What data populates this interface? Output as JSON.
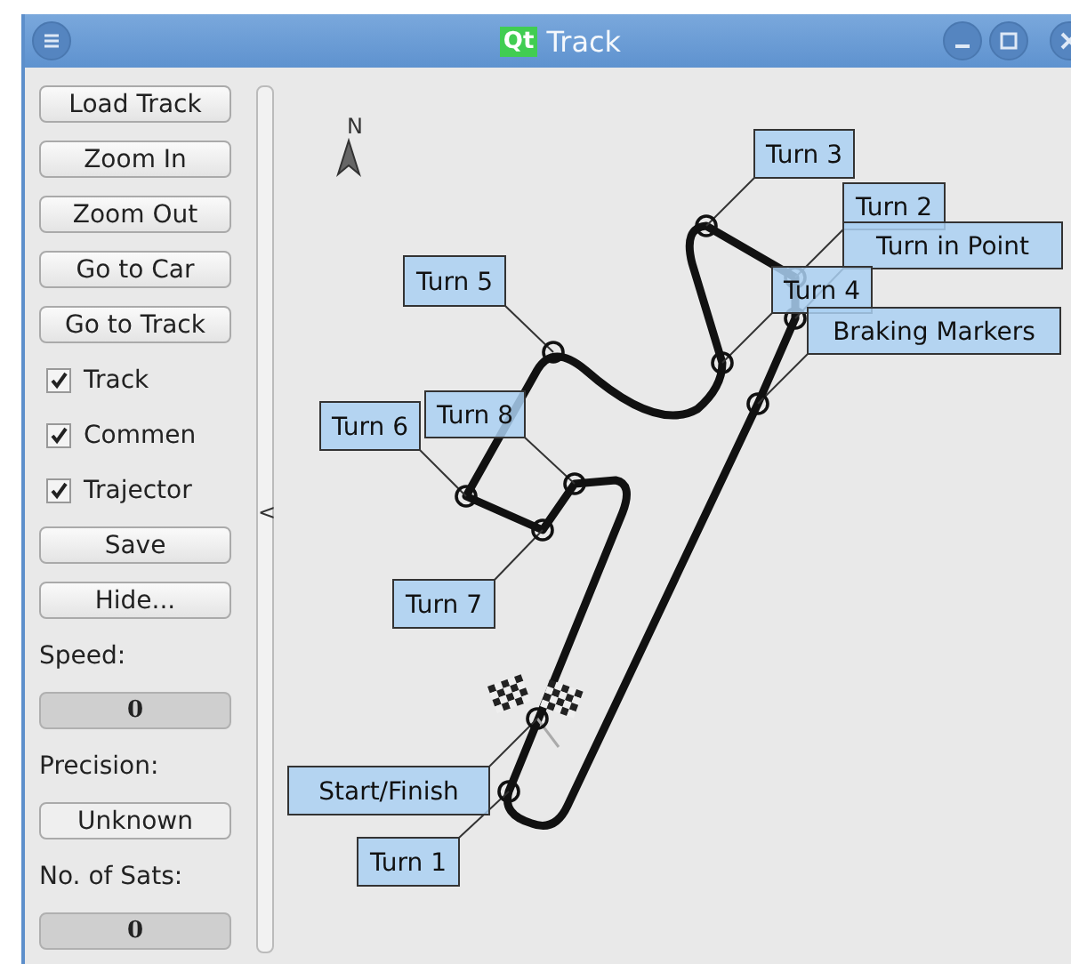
{
  "window": {
    "logo": "Qt",
    "title": "Track"
  },
  "sidebar": {
    "items": [
      {
        "kind": "button",
        "label": "Load Track"
      },
      {
        "kind": "button",
        "label": "Zoom In"
      },
      {
        "kind": "button",
        "label": "Zoom Out"
      },
      {
        "kind": "button",
        "label": "Go to Car"
      },
      {
        "kind": "button",
        "label": "Go to Track"
      },
      {
        "kind": "checkbox",
        "label": "Track",
        "checked": true
      },
      {
        "kind": "checkbox",
        "label": "Commen",
        "checked": true
      },
      {
        "kind": "checkbox",
        "label": "Trajector",
        "checked": true
      },
      {
        "kind": "button",
        "label": "Save"
      },
      {
        "kind": "button",
        "label": "Hide..."
      },
      {
        "kind": "label",
        "label": "Speed:"
      },
      {
        "kind": "readout",
        "label": "0"
      },
      {
        "kind": "label",
        "label": "Precision:"
      },
      {
        "kind": "field",
        "label": "Unknown"
      },
      {
        "kind": "label",
        "label": "No. of Sats:"
      },
      {
        "kind": "readout",
        "label": "0"
      }
    ]
  },
  "splitter": {
    "handle": "<"
  },
  "map": {
    "compass": "N",
    "markers": [
      {
        "label": "Turn 3"
      },
      {
        "label": "Turn 2"
      },
      {
        "label": "Turn in Point"
      },
      {
        "label": "Turn 5"
      },
      {
        "label": "Turn 4"
      },
      {
        "label": "Braking Markers"
      },
      {
        "label": "Turn 6"
      },
      {
        "label": "Turn 8"
      },
      {
        "label": "Turn 7"
      },
      {
        "label": "Start/Finish"
      },
      {
        "label": "Turn 1"
      }
    ]
  }
}
